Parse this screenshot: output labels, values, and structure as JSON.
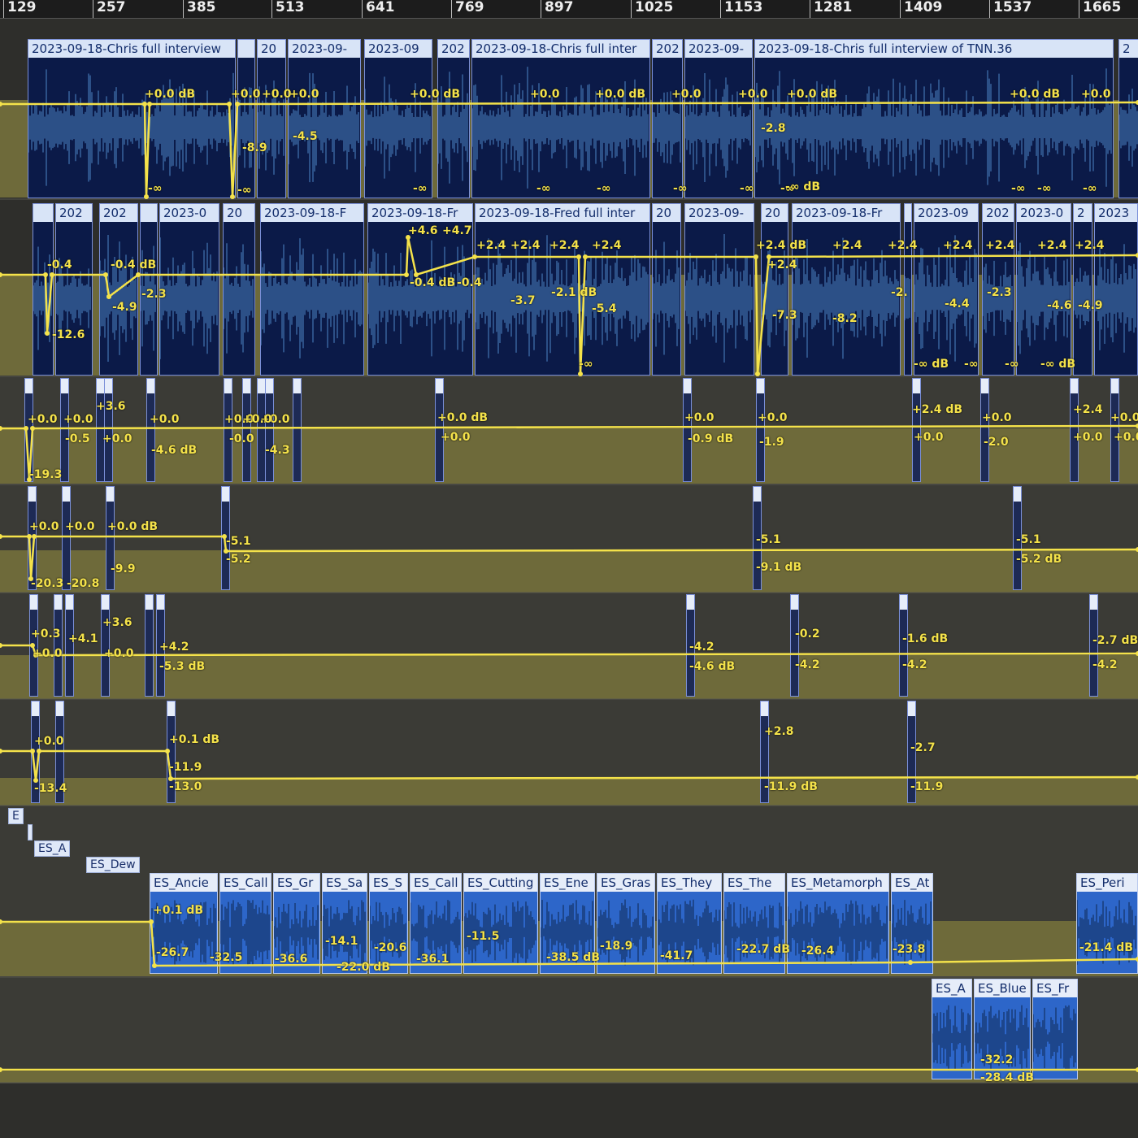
{
  "ruler": {
    "ticks": [
      "129",
      "257",
      "385",
      "513",
      "641",
      "769",
      "897",
      "1025",
      "1153",
      "1281",
      "1409",
      "1537",
      "1665"
    ]
  },
  "tracks": [
    {
      "id": "vo1",
      "regions": [
        {
          "label": "2023-09-18-Chris full interview",
          "kind": "dialog"
        },
        {
          "label": "",
          "kind": "dialog"
        },
        {
          "label": "20",
          "kind": "dialog"
        },
        {
          "label": "2023-09-",
          "kind": "dialog"
        },
        {
          "label": "2023-09",
          "kind": "dialog"
        },
        {
          "label": "202",
          "kind": "dialog"
        },
        {
          "label": "2023-09-18-Chris full inter",
          "kind": "dialog"
        },
        {
          "label": "202",
          "kind": "dialog"
        },
        {
          "label": "2023-09-",
          "kind": "dialog"
        },
        {
          "label": "2023-09-18-Chris full interview of TNN.36",
          "kind": "dialog"
        },
        {
          "label": "2",
          "kind": "dialog"
        }
      ],
      "labels": [
        "+0.0 dB",
        "+0.0",
        "+0.0",
        "+0.0",
        "-8.9",
        "-4.5",
        "+0.0 dB",
        "+0.0",
        "+0.0 dB",
        "+0.0",
        "+0.0",
        "-2.8",
        "+0.0 dB",
        "+0.0 dB",
        "+0.0",
        "-∞",
        "-∞",
        "-∞",
        "-∞",
        "-∞",
        "-∞",
        "-∞",
        "-∞",
        "-∞ dB",
        "-∞",
        "-∞",
        "-∞"
      ]
    },
    {
      "id": "vo2",
      "regions": [
        {
          "label": "",
          "kind": "dialog"
        },
        {
          "label": "202",
          "kind": "dialog"
        },
        {
          "label": "202",
          "kind": "dialog"
        },
        {
          "label": "",
          "kind": "dialog"
        },
        {
          "label": "2023-0",
          "kind": "dialog"
        },
        {
          "label": "20",
          "kind": "dialog"
        },
        {
          "label": "2023-09-18-F",
          "kind": "dialog"
        },
        {
          "label": "2023-09-18-Fr",
          "kind": "dialog"
        },
        {
          "label": "2023-09-18-Fred full inter",
          "kind": "dialog"
        },
        {
          "label": "20",
          "kind": "dialog"
        },
        {
          "label": "2023-09-",
          "kind": "dialog"
        },
        {
          "label": "20",
          "kind": "dialog"
        },
        {
          "label": "2023-09-18-Fr",
          "kind": "dialog"
        },
        {
          "label": "",
          "kind": "dialog"
        },
        {
          "label": "2023-09",
          "kind": "dialog"
        },
        {
          "label": "202",
          "kind": "dialog"
        },
        {
          "label": "2023-0",
          "kind": "dialog"
        },
        {
          "label": "2",
          "kind": "dialog"
        },
        {
          "label": "2023",
          "kind": "dialog"
        }
      ],
      "labels": [
        "-0.4",
        "-0.4 dB",
        "-12.6",
        "-4.9",
        "-2.3",
        "+4.6",
        "+4.7",
        "-0.4 dB",
        "-0.4",
        "+2.4",
        "+2.4",
        "+2.4",
        "+2.4",
        "-3.7",
        "-2.1 dB",
        "-5.4",
        "-∞",
        "+2.4 dB",
        "+2.4",
        "-7.3",
        "+2.4",
        "-8.2",
        "+2.4",
        "+2.4",
        "+2.4",
        "+2.4",
        "+2.4",
        "-2.",
        "-4.4",
        "-2.3",
        "-4.6",
        "-4.9",
        "-∞ dB",
        "-∞",
        "-∞",
        "-∞ dB"
      ]
    },
    {
      "id": "t3",
      "labels": [
        "+0.0",
        "+0.0",
        "+3.6",
        "+0.0",
        "+0.0",
        "+0.0",
        "+0.0",
        "+0.0 dB",
        "+0.0",
        "+0.0",
        "+2.4 dB",
        "+0.0",
        "+2.4",
        "+0.0",
        "-19.3",
        "-0.5",
        "+0.0",
        "-4.6 dB",
        "-0.0",
        "-4.3",
        "+0.0",
        "-0.9 dB",
        "-1.9",
        "+0.0",
        "-2.0",
        "+0.0",
        "+0.0"
      ]
    },
    {
      "id": "t4",
      "labels": [
        "+0.0",
        "+0.0",
        "+0.0 dB",
        "-5.1",
        "-5.1",
        "-5.1",
        "-9.9",
        "-5.2",
        "-9.1 dB",
        "-5.2 dB",
        "-20.3",
        "-20.8"
      ]
    },
    {
      "id": "t5",
      "labels": [
        "+0.3",
        "+0.0",
        "+4.1",
        "+3.6",
        "+0.0",
        "+4.2",
        "-5.3 dB",
        "-4.2",
        "-4.6 dB",
        "-0.2",
        "-4.2",
        "-1.6 dB",
        "-4.2",
        "-2.7 dB",
        "-4.2"
      ]
    },
    {
      "id": "t6",
      "labels": [
        "+0.0",
        "-13.4",
        "+0.1 dB",
        "-11.9",
        "-13.0",
        "+2.8",
        "-11.9 dB",
        "-2.7",
        "-11.9"
      ]
    },
    {
      "id": "sfx1",
      "tags": [
        "E",
        "ES_A",
        "ES_Dew"
      ],
      "regions": [
        {
          "label": "ES_Ancie",
          "kind": "sfx"
        },
        {
          "label": "ES_Call",
          "kind": "sfx"
        },
        {
          "label": "ES_Gr",
          "kind": "sfx"
        },
        {
          "label": "ES_Sa",
          "kind": "sfx"
        },
        {
          "label": "ES_S",
          "kind": "sfx"
        },
        {
          "label": "ES_Call",
          "kind": "sfx"
        },
        {
          "label": "ES_Cutting",
          "kind": "sfx"
        },
        {
          "label": "ES_Ene",
          "kind": "sfx"
        },
        {
          "label": "ES_Gras",
          "kind": "sfx"
        },
        {
          "label": "ES_They",
          "kind": "sfx"
        },
        {
          "label": "ES_The",
          "kind": "sfx"
        },
        {
          "label": "ES_Metamorph",
          "kind": "sfx"
        },
        {
          "label": "ES_At",
          "kind": "sfx"
        },
        {
          "label": "ES_Peri",
          "kind": "sfx"
        }
      ],
      "labels": [
        "+0.1 dB",
        "-26.7",
        "-32.5",
        "-36.6",
        "-14.1",
        "-22.0 dB",
        "-20.6",
        "-36.1",
        "-11.5",
        "-38.5 dB",
        "-18.9",
        "-41.7",
        "-22.7 dB",
        "-26.4",
        "-23.8",
        "-21.4 dB"
      ]
    },
    {
      "id": "sfx2",
      "regions": [
        {
          "label": "ES_A",
          "kind": "sfx"
        },
        {
          "label": "ES_Blue",
          "kind": "sfx"
        },
        {
          "label": "ES_Fr",
          "kind": "sfx"
        }
      ],
      "labels": [
        "-32.2",
        "-28.4 dB"
      ]
    }
  ],
  "colors": {
    "automation": "#f4e24a",
    "trackFill": "#6e6a3a",
    "dialogRegion": "#0b1a48",
    "sfxRegion": "#2d66c9",
    "header": "#d8e4f7"
  }
}
